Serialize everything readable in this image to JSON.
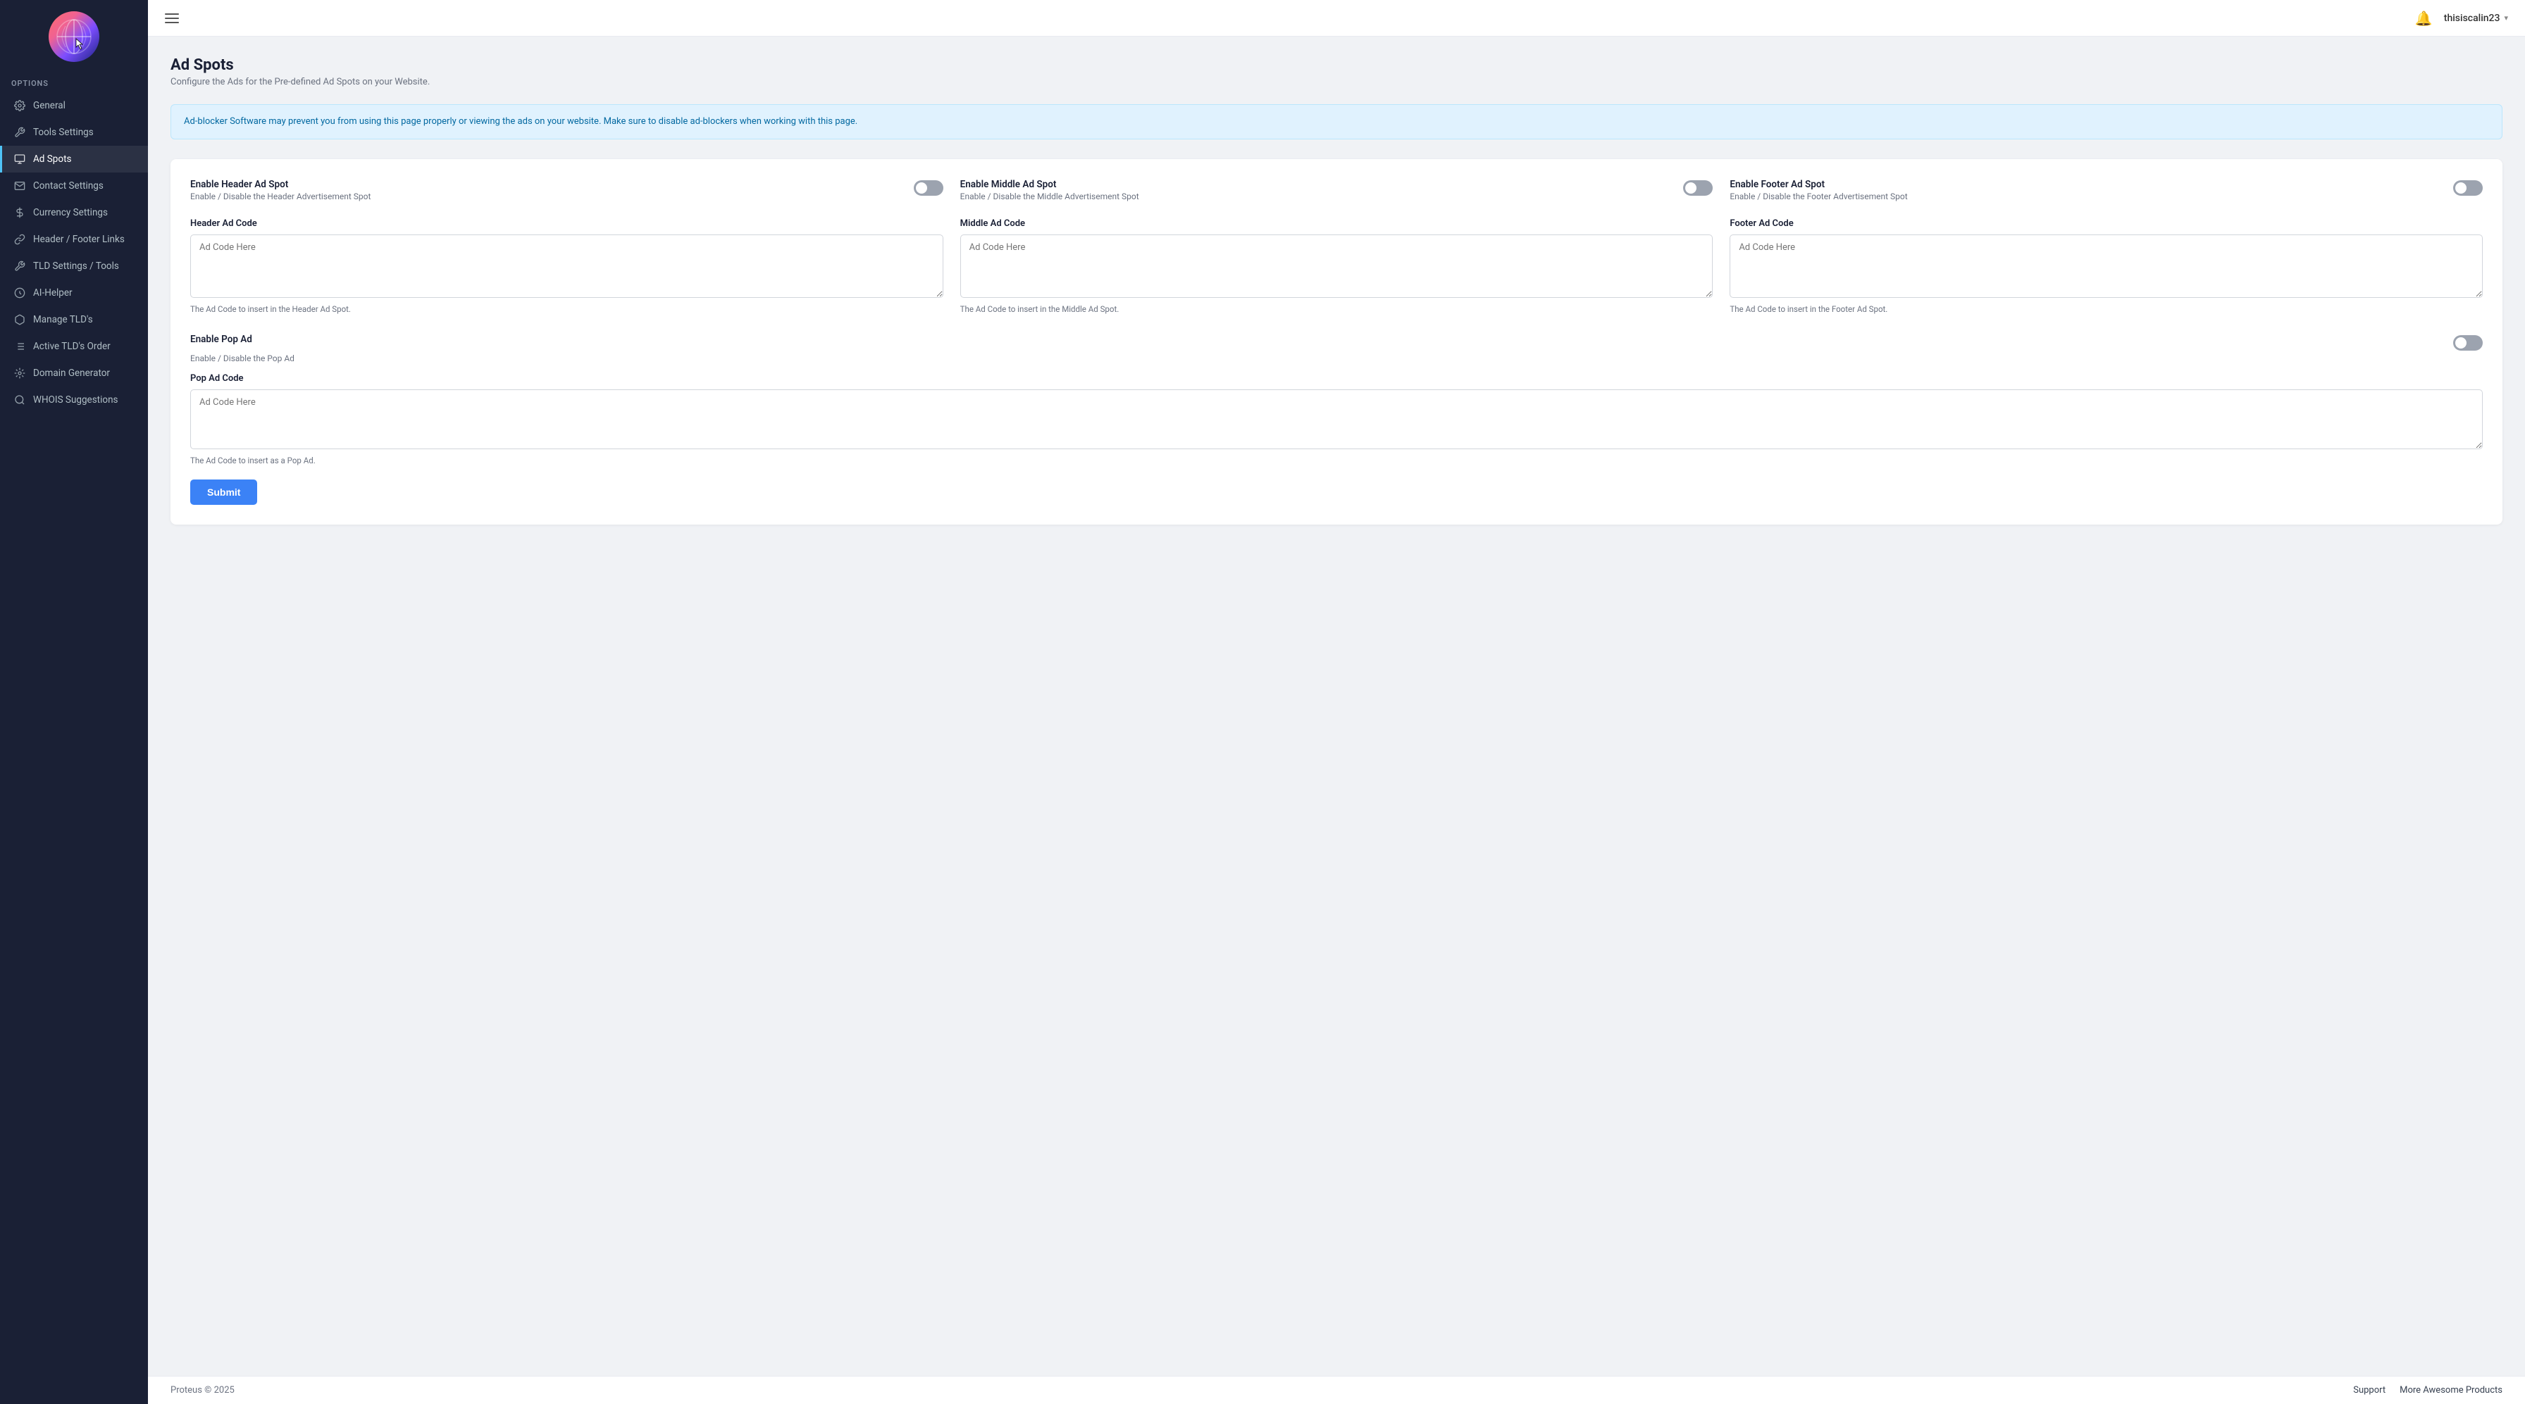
{
  "sidebar": {
    "section_label": "Options",
    "items": [
      {
        "id": "general",
        "label": "General",
        "icon": "settings-icon",
        "active": false
      },
      {
        "id": "tools-settings",
        "label": "Tools Settings",
        "icon": "wrench-icon",
        "active": false
      },
      {
        "id": "ad-spots",
        "label": "Ad Spots",
        "icon": "monitor-icon",
        "active": true
      },
      {
        "id": "contact-settings",
        "label": "Contact Settings",
        "icon": "mail-icon",
        "active": false
      },
      {
        "id": "currency-settings",
        "label": "Currency Settings",
        "icon": "dollar-icon",
        "active": false
      },
      {
        "id": "header-footer-links",
        "label": "Header / Footer Links",
        "icon": "link-icon",
        "active": false
      },
      {
        "id": "tld-settings-tools",
        "label": "TLD Settings / Tools",
        "icon": "tool-icon",
        "active": false
      },
      {
        "id": "ai-helper",
        "label": "AI-Helper",
        "icon": "ai-icon",
        "active": false
      },
      {
        "id": "manage-tlds",
        "label": "Manage TLD's",
        "icon": "manage-icon",
        "active": false
      },
      {
        "id": "active-tlds-order",
        "label": "Active TLD's Order",
        "icon": "order-icon",
        "active": false
      },
      {
        "id": "domain-generator",
        "label": "Domain Generator",
        "icon": "generator-icon",
        "active": false
      },
      {
        "id": "whois-suggestions",
        "label": "WHOIS Suggestions",
        "icon": "whois-icon",
        "active": false
      }
    ]
  },
  "topbar": {
    "hamburger_label": "Menu",
    "notification_label": "Notifications",
    "user": "thisiscalin23",
    "chevron": "▾"
  },
  "page": {
    "title": "Ad Spots",
    "subtitle": "Configure the Ads for the Pre-defined Ad Spots on your Website.",
    "alert": "Ad-blocker Software may prevent you from using this page properly or viewing the ads on your website. Make sure to disable ad-blockers when working with this page."
  },
  "toggles": [
    {
      "id": "header-ad-spot",
      "label": "Enable Header Ad Spot",
      "desc": "Enable / Disable the Header Advertisement Spot",
      "checked": false
    },
    {
      "id": "middle-ad-spot",
      "label": "Enable Middle Ad Spot",
      "desc": "Enable / Disable the Middle Advertisement Spot",
      "checked": false
    },
    {
      "id": "footer-ad-spot",
      "label": "Enable Footer Ad Spot",
      "desc": "Enable / Disable the Footer Advertisement Spot",
      "checked": false
    }
  ],
  "ad_codes": [
    {
      "id": "header-ad-code",
      "label": "Header Ad Code",
      "placeholder": "Ad Code Here",
      "hint": "The Ad Code to insert in the Header Ad Spot."
    },
    {
      "id": "middle-ad-code",
      "label": "Middle Ad Code",
      "placeholder": "Ad Code Here",
      "hint": "The Ad Code to insert in the Middle Ad Spot."
    },
    {
      "id": "footer-ad-code",
      "label": "Footer Ad Code",
      "placeholder": "Ad Code Here",
      "hint": "The Ad Code to insert in the Footer Ad Spot."
    }
  ],
  "pop_ad": {
    "toggle": {
      "label": "Enable Pop Ad",
      "desc": "Enable / Disable the Pop Ad",
      "checked": false
    },
    "code": {
      "label": "Pop Ad Code",
      "placeholder": "Ad Code Here",
      "hint": "The Ad Code to insert as a Pop Ad."
    }
  },
  "submit_button": "Submit",
  "footer": {
    "copyright": "Proteus © 2025",
    "links": [
      "Support",
      "More Awesome Products"
    ]
  }
}
